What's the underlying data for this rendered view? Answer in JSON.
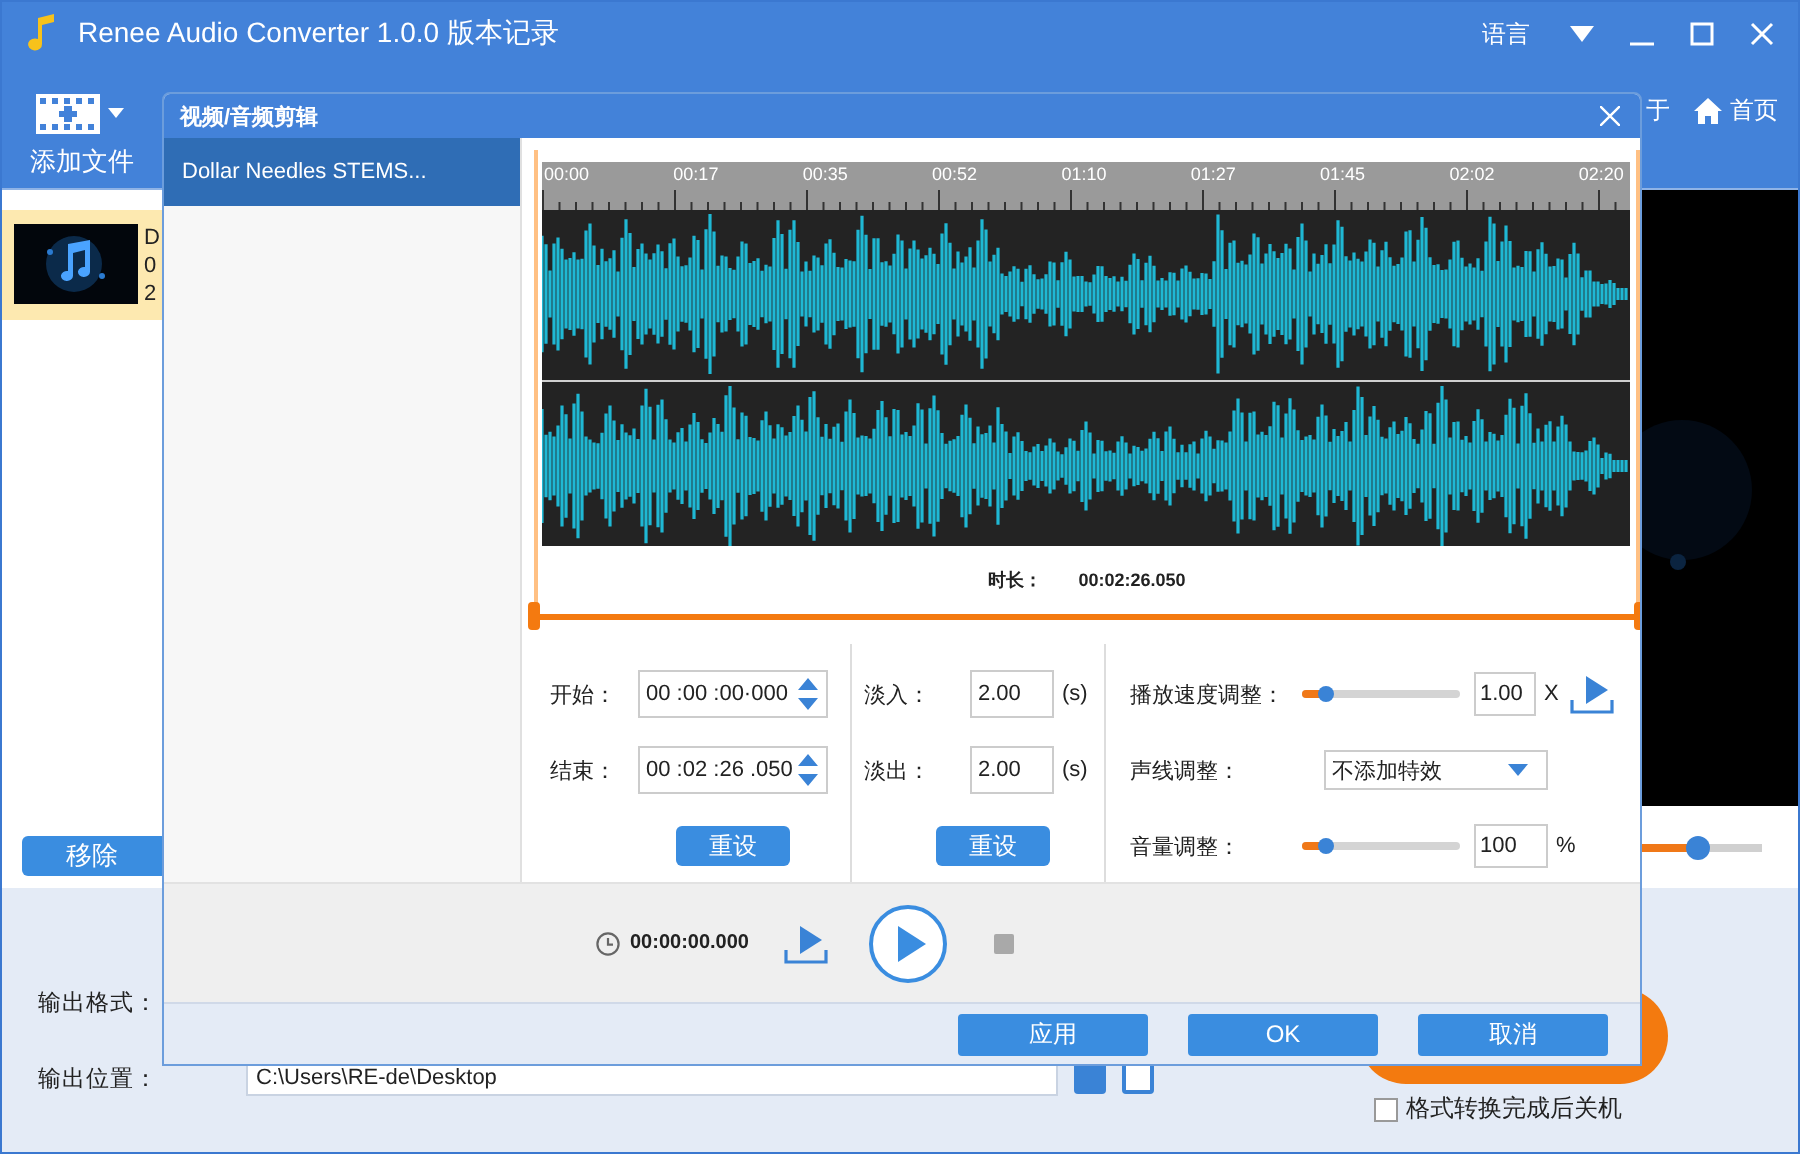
{
  "window": {
    "title": "Renee Audio Converter 1.0.0 版本记录",
    "language": "语言"
  },
  "toolbar": {
    "add_file": "添加文件",
    "about": "于",
    "home": "首页"
  },
  "file_list": [
    {
      "lines": [
        "D",
        "0",
        "2"
      ],
      "selected": true
    }
  ],
  "remove_button": "移除",
  "preview_slider": {
    "level": 0.47
  },
  "output": {
    "format_label": "输出格式：",
    "location_label": "输出位置：",
    "location_value": "C:\\Users\\RE-de\\Desktop",
    "shutdown": {
      "label": "格式转换完成后关机",
      "checked": false
    }
  },
  "dialog": {
    "title": "视频/音频剪辑",
    "files": [
      {
        "name": "Dollar Needles STEMS...",
        "selected": true
      }
    ],
    "ruler": [
      "00:00",
      "00:17",
      "00:35",
      "00:52",
      "01:10",
      "01:27",
      "01:45",
      "02:02",
      "02:20"
    ],
    "duration_label": "时长：",
    "duration": "00:02:26.050",
    "trim": {
      "start_label": "开始：",
      "start": "00 :00 :00·000",
      "end_label": "结束：",
      "end": "00 :02 :26 .050",
      "reset": "重设"
    },
    "fade": {
      "in_label": "淡入：",
      "in": "2.00",
      "in_unit": "(s)",
      "out_label": "淡出：",
      "out": "2.00",
      "out_unit": "(s)",
      "reset": "重设"
    },
    "speed": {
      "label": "播放速度调整：",
      "level": 0.15,
      "value": "1.00",
      "unit": "X"
    },
    "voice": {
      "label": "声线调整：",
      "value": "不添加特效"
    },
    "volume": {
      "label": "音量调整：",
      "level": 0.15,
      "value": "100",
      "unit": "%"
    },
    "player": {
      "time": "00:00:00.000"
    },
    "buttons": [
      "应用",
      "OK",
      "取消"
    ]
  }
}
